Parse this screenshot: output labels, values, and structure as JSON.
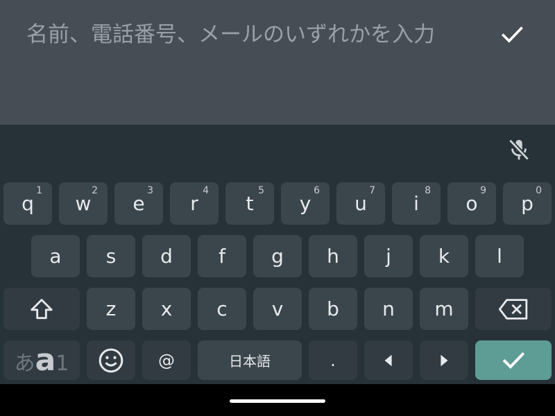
{
  "input": {
    "placeholder": "名前、電話番号、メールのいずれかを入力",
    "value": ""
  },
  "icons": {
    "submit": "check-icon",
    "mic": "mic-off-icon",
    "shift": "shift-icon",
    "backspace": "backspace-icon",
    "emoji": "emoji-icon",
    "left": "cursor-left-icon",
    "right": "cursor-right-icon",
    "enter": "check-icon"
  },
  "colors": {
    "input_bg": "#474d55",
    "keyboard_bg": "#263238",
    "key_bg": "#3b454c",
    "enter_bg": "#5e9c96"
  },
  "keyboard": {
    "row1": [
      {
        "label": "q",
        "hint": "1"
      },
      {
        "label": "w",
        "hint": "2"
      },
      {
        "label": "e",
        "hint": "3"
      },
      {
        "label": "r",
        "hint": "4"
      },
      {
        "label": "t",
        "hint": "5"
      },
      {
        "label": "y",
        "hint": "6"
      },
      {
        "label": "u",
        "hint": "7"
      },
      {
        "label": "i",
        "hint": "8"
      },
      {
        "label": "o",
        "hint": "9"
      },
      {
        "label": "p",
        "hint": "0"
      }
    ],
    "row2": [
      "a",
      "s",
      "d",
      "f",
      "g",
      "h",
      "j",
      "k",
      "l"
    ],
    "row3": [
      "z",
      "x",
      "c",
      "v",
      "b",
      "n",
      "m"
    ],
    "bottom": {
      "mode_hira": "あ",
      "mode_alpha": "a",
      "mode_num": "1",
      "at": "@",
      "space": "日本語",
      "period": "."
    }
  }
}
